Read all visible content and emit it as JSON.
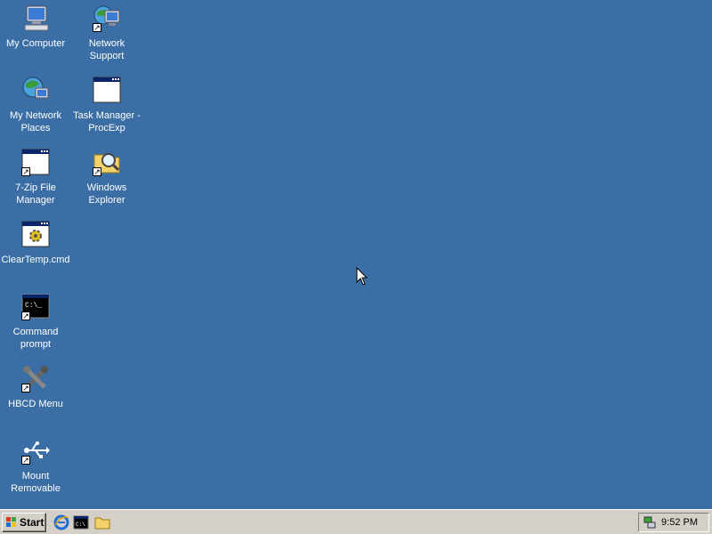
{
  "desktop": {
    "icons": [
      {
        "label": "My Computer",
        "icon": "my-computer-icon"
      },
      {
        "label": "Network\nSupport",
        "icon": "network-support-icon"
      },
      {
        "label": "My Network\nPlaces",
        "icon": "my-network-places-icon"
      },
      {
        "label": "Task Manager -\nProcExp",
        "icon": "task-manager-icon"
      },
      {
        "label": "7-Zip File\nManager",
        "icon": "7zip-icon"
      },
      {
        "label": "Windows\nExplorer",
        "icon": "windows-explorer-icon"
      },
      {
        "label": "ClearTemp.cmd",
        "icon": "cmd-script-icon"
      },
      {
        "label": "Command\nprompt",
        "icon": "command-prompt-icon"
      },
      {
        "label": "HBCD Menu",
        "icon": "hbcd-menu-icon"
      },
      {
        "label": "Mount\nRemovable",
        "icon": "usb-icon"
      }
    ],
    "background_color": "#3a6ea5"
  },
  "taskbar": {
    "start_label": "Start",
    "quick_launch": [
      "internet-explorer-icon",
      "command-prompt-icon",
      "folder-icon"
    ],
    "tray": {
      "clock": "9:52 PM",
      "icon": "network-tray-icon"
    }
  }
}
